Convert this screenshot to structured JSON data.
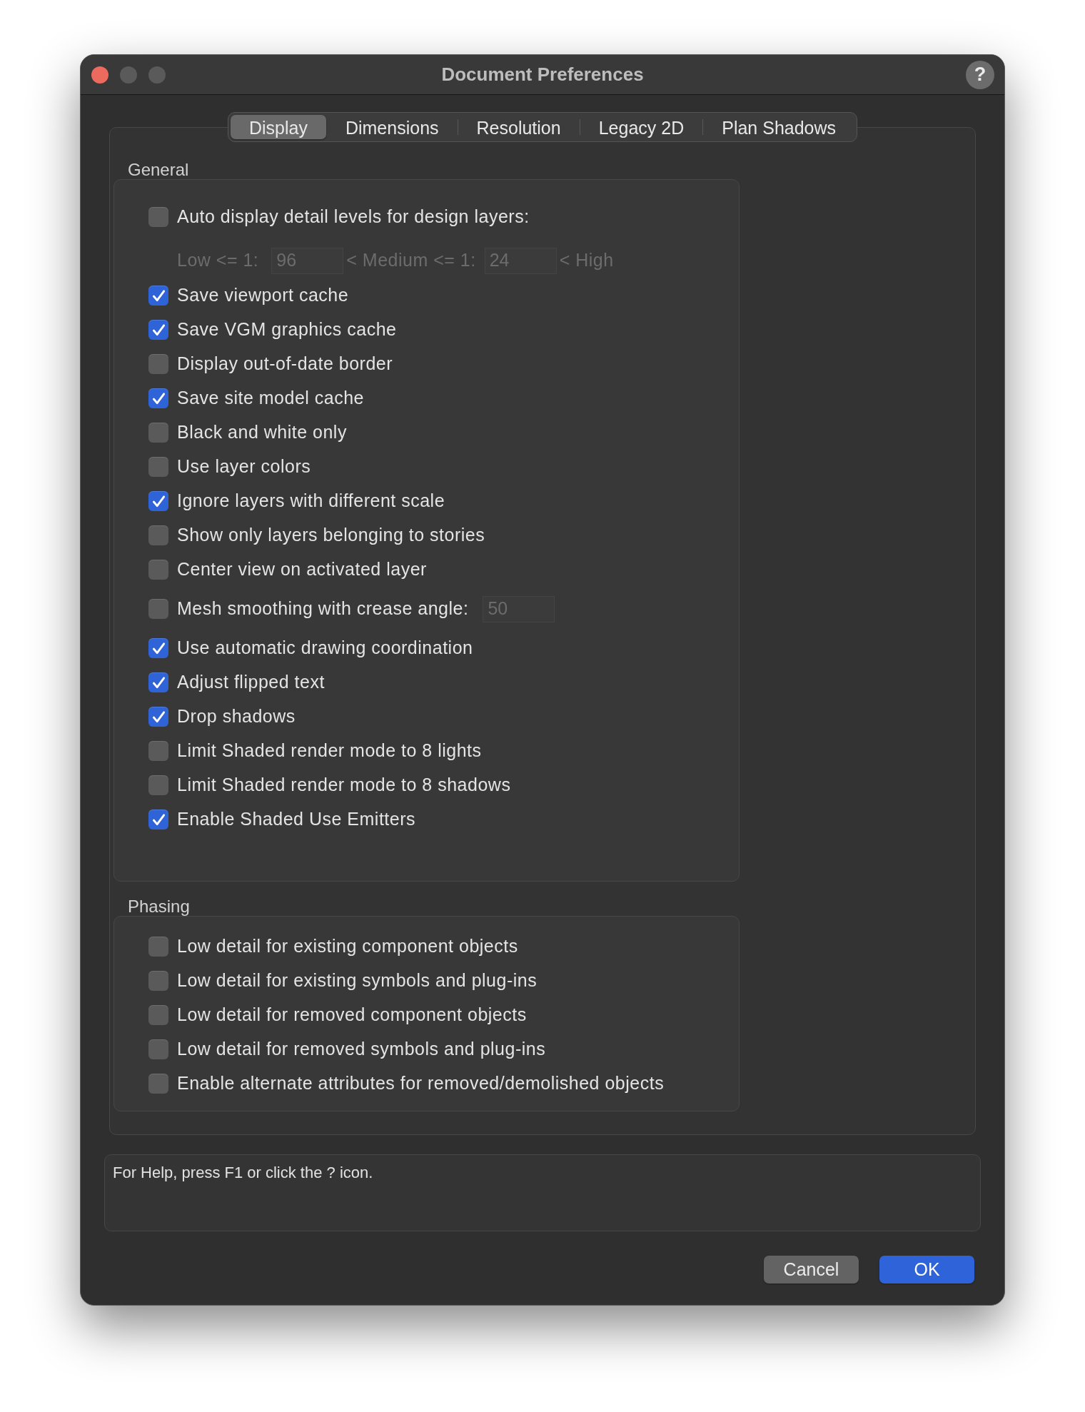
{
  "window": {
    "title": "Document Preferences",
    "help_button": "?"
  },
  "tabs": [
    {
      "label": "Display",
      "selected": true
    },
    {
      "label": "Dimensions",
      "selected": false
    },
    {
      "label": "Resolution",
      "selected": false
    },
    {
      "label": "Legacy 2D",
      "selected": false
    },
    {
      "label": "Plan Shadows",
      "selected": false
    }
  ],
  "sections": [
    {
      "title": "General",
      "options": [
        {
          "kind": "checkbox",
          "label": "Auto display detail levels for design layers:",
          "checked": false
        },
        {
          "kind": "levels",
          "disabled": true,
          "fields": [
            {
              "label": "Low <= 1:",
              "value": "96"
            },
            {
              "label": "< Medium <= 1:",
              "value": "24"
            }
          ],
          "suffix": "< High"
        },
        {
          "kind": "checkbox",
          "label": "Save viewport cache",
          "checked": true
        },
        {
          "kind": "checkbox",
          "label": "Save VGM graphics cache",
          "checked": true
        },
        {
          "kind": "checkbox",
          "label": "Display out-of-date border",
          "checked": false
        },
        {
          "kind": "checkbox",
          "label": "Save site model cache",
          "checked": true
        },
        {
          "kind": "checkbox",
          "label": "Black and white only",
          "checked": false
        },
        {
          "kind": "checkbox",
          "label": "Use layer colors",
          "checked": false
        },
        {
          "kind": "checkbox",
          "label": "Ignore layers with different scale",
          "checked": true
        },
        {
          "kind": "checkbox",
          "label": "Show only layers belonging to stories",
          "checked": false
        },
        {
          "kind": "checkbox",
          "label": "Center view on activated layer",
          "checked": false
        },
        {
          "kind": "checkbox_field",
          "label": "Mesh smoothing with crease angle:",
          "checked": false,
          "value": "50",
          "field_disabled": true
        },
        {
          "kind": "checkbox",
          "label": "Use automatic drawing coordination",
          "checked": true
        },
        {
          "kind": "checkbox",
          "label": "Adjust flipped text",
          "checked": true
        },
        {
          "kind": "checkbox",
          "label": "Drop shadows",
          "checked": true
        },
        {
          "kind": "checkbox",
          "label": "Limit Shaded render mode to 8 lights",
          "checked": false
        },
        {
          "kind": "checkbox",
          "label": "Limit Shaded render mode to 8 shadows",
          "checked": false
        },
        {
          "kind": "checkbox",
          "label": "Enable Shaded Use Emitters",
          "checked": true
        }
      ]
    },
    {
      "title": "Phasing",
      "options": [
        {
          "kind": "checkbox",
          "label": "Low detail for existing component objects",
          "checked": false
        },
        {
          "kind": "checkbox",
          "label": "Low detail for existing symbols and plug-ins",
          "checked": false
        },
        {
          "kind": "checkbox",
          "label": "Low detail for removed component objects",
          "checked": false
        },
        {
          "kind": "checkbox",
          "label": "Low detail for removed symbols and plug-ins",
          "checked": false
        },
        {
          "kind": "checkbox",
          "label": "Enable alternate attributes for removed/demolished objects",
          "checked": false
        }
      ]
    }
  ],
  "help_text": "For Help, press F1 or click the ? icon.",
  "buttons": [
    {
      "label": "Cancel",
      "kind": "secondary"
    },
    {
      "label": "OK",
      "kind": "default"
    }
  ]
}
